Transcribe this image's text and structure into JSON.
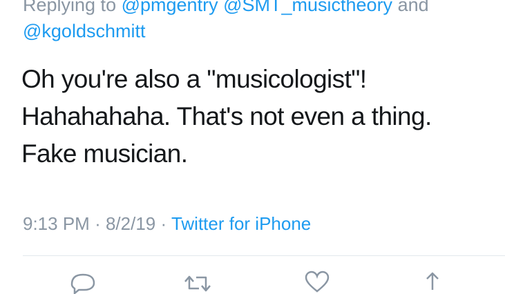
{
  "reply": {
    "prefix": "Replying to",
    "mention1": "@pmgentry",
    "mention2": "@SMT_musictheory",
    "conj": "and",
    "mention3": "@kgoldschmitt"
  },
  "tweet": {
    "lines": [
      "Oh you're also a \"musicologist\"!",
      "Hahahahaha. That's not even a thing.",
      "Fake musician."
    ]
  },
  "meta": {
    "time": "9:13 PM",
    "sep1": "·",
    "date": "8/2/19",
    "sep2": "·",
    "source": "Twitter for iPhone"
  },
  "actions": {
    "icons": [
      "reply-icon",
      "retweet-icon",
      "like-icon",
      "share-icon"
    ],
    "icon_color": "#8a96a3"
  },
  "colors": {
    "link": "#1d9bf0",
    "muted": "#8a96a3",
    "text": "#14171a",
    "divider": "#e1e8ed"
  }
}
